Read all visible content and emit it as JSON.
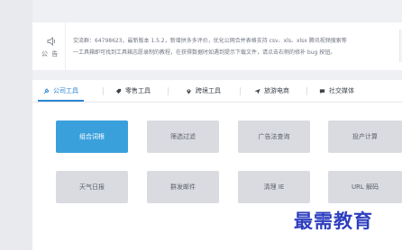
{
  "notice": {
    "label": "公 告",
    "line1": "交流群：64798623，最新版本 1.5.2，新增拼多多评价，优化公网合并表格支持 csv、xls、xlsx 腾讯视频搜索等",
    "line2": "一工具箱即可找到工具箱志愿录制的教程，在获得数据时如遇到提示下载文件，请点击右侧的修补 bug 按钮。"
  },
  "tabs": [
    {
      "label": "公司工具",
      "icon": "wrench-icon",
      "active": true
    },
    {
      "label": "零售工具",
      "icon": "tag-icon",
      "active": false
    },
    {
      "label": "跨境工具",
      "icon": "location-pin-icon",
      "active": false
    },
    {
      "label": "旅游电商",
      "icon": "paper-plane-icon",
      "active": false
    },
    {
      "label": "社交媒体",
      "icon": "chat-bubble-icon",
      "active": false
    }
  ],
  "tools": [
    {
      "label": "组合词根",
      "primary": true
    },
    {
      "label": "筛选过滤",
      "primary": false
    },
    {
      "label": "广告法查询",
      "primary": false
    },
    {
      "label": "投产计算",
      "primary": false
    },
    {
      "label": "天气日报",
      "primary": false
    },
    {
      "label": "群发邮件",
      "primary": false
    },
    {
      "label": "清理 IE",
      "primary": false
    },
    {
      "label": "URL 解码",
      "primary": false
    }
  ],
  "watermark": "最需教育",
  "colors": {
    "accent": "#2c86d4",
    "primary_button": "#3aa0dc",
    "watermark": "#2e3fbf"
  }
}
